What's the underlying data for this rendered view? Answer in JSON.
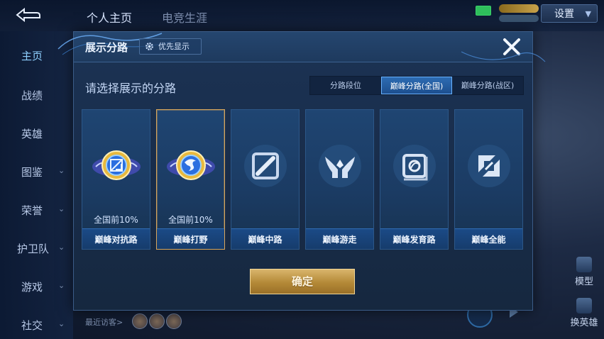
{
  "background": {
    "tabs": [
      "个人主页",
      "电竞生涯"
    ],
    "settings_label": "设置",
    "sidebar": [
      {
        "label": "主页",
        "has_chevron": false
      },
      {
        "label": "战绩",
        "has_chevron": false
      },
      {
        "label": "英雄",
        "has_chevron": false
      },
      {
        "label": "图鉴",
        "has_chevron": true
      },
      {
        "label": "荣誉",
        "has_chevron": true
      },
      {
        "label": "护卫队",
        "has_chevron": true
      },
      {
        "label": "游戏",
        "has_chevron": true
      },
      {
        "label": "社交",
        "has_chevron": true
      }
    ],
    "visitors_label": "最近访客>",
    "right_buttons": [
      "模型",
      "换英雄"
    ]
  },
  "dialog": {
    "title": "展示分路",
    "priority_label": "优先显示",
    "prompt": "请选择展示的分路",
    "segments": [
      "分路段位",
      "巅峰分路(全国)",
      "巅峰分路(战区)"
    ],
    "active_segment": 1,
    "cards": [
      {
        "name": "巅峰对抗路",
        "rank": "全国前10%",
        "icon": "sword-emblem-icon",
        "selected": false
      },
      {
        "name": "巅峰打野",
        "rank": "全国前10%",
        "icon": "dragon-emblem-icon",
        "selected": true
      },
      {
        "name": "巅峰中路",
        "rank": "",
        "icon": "mid-lane-icon",
        "selected": false
      },
      {
        "name": "巅峰游走",
        "rank": "",
        "icon": "wings-icon",
        "selected": false
      },
      {
        "name": "巅峰发育路",
        "rank": "",
        "icon": "marksman-icon",
        "selected": false
      },
      {
        "name": "巅峰全能",
        "rank": "",
        "icon": "all-round-icon",
        "selected": false
      }
    ],
    "confirm_label": "确定"
  },
  "colors": {
    "accent_blue": "#2d6cb3",
    "gold": "#d9b56c",
    "selected_border": "#d9a75c"
  }
}
